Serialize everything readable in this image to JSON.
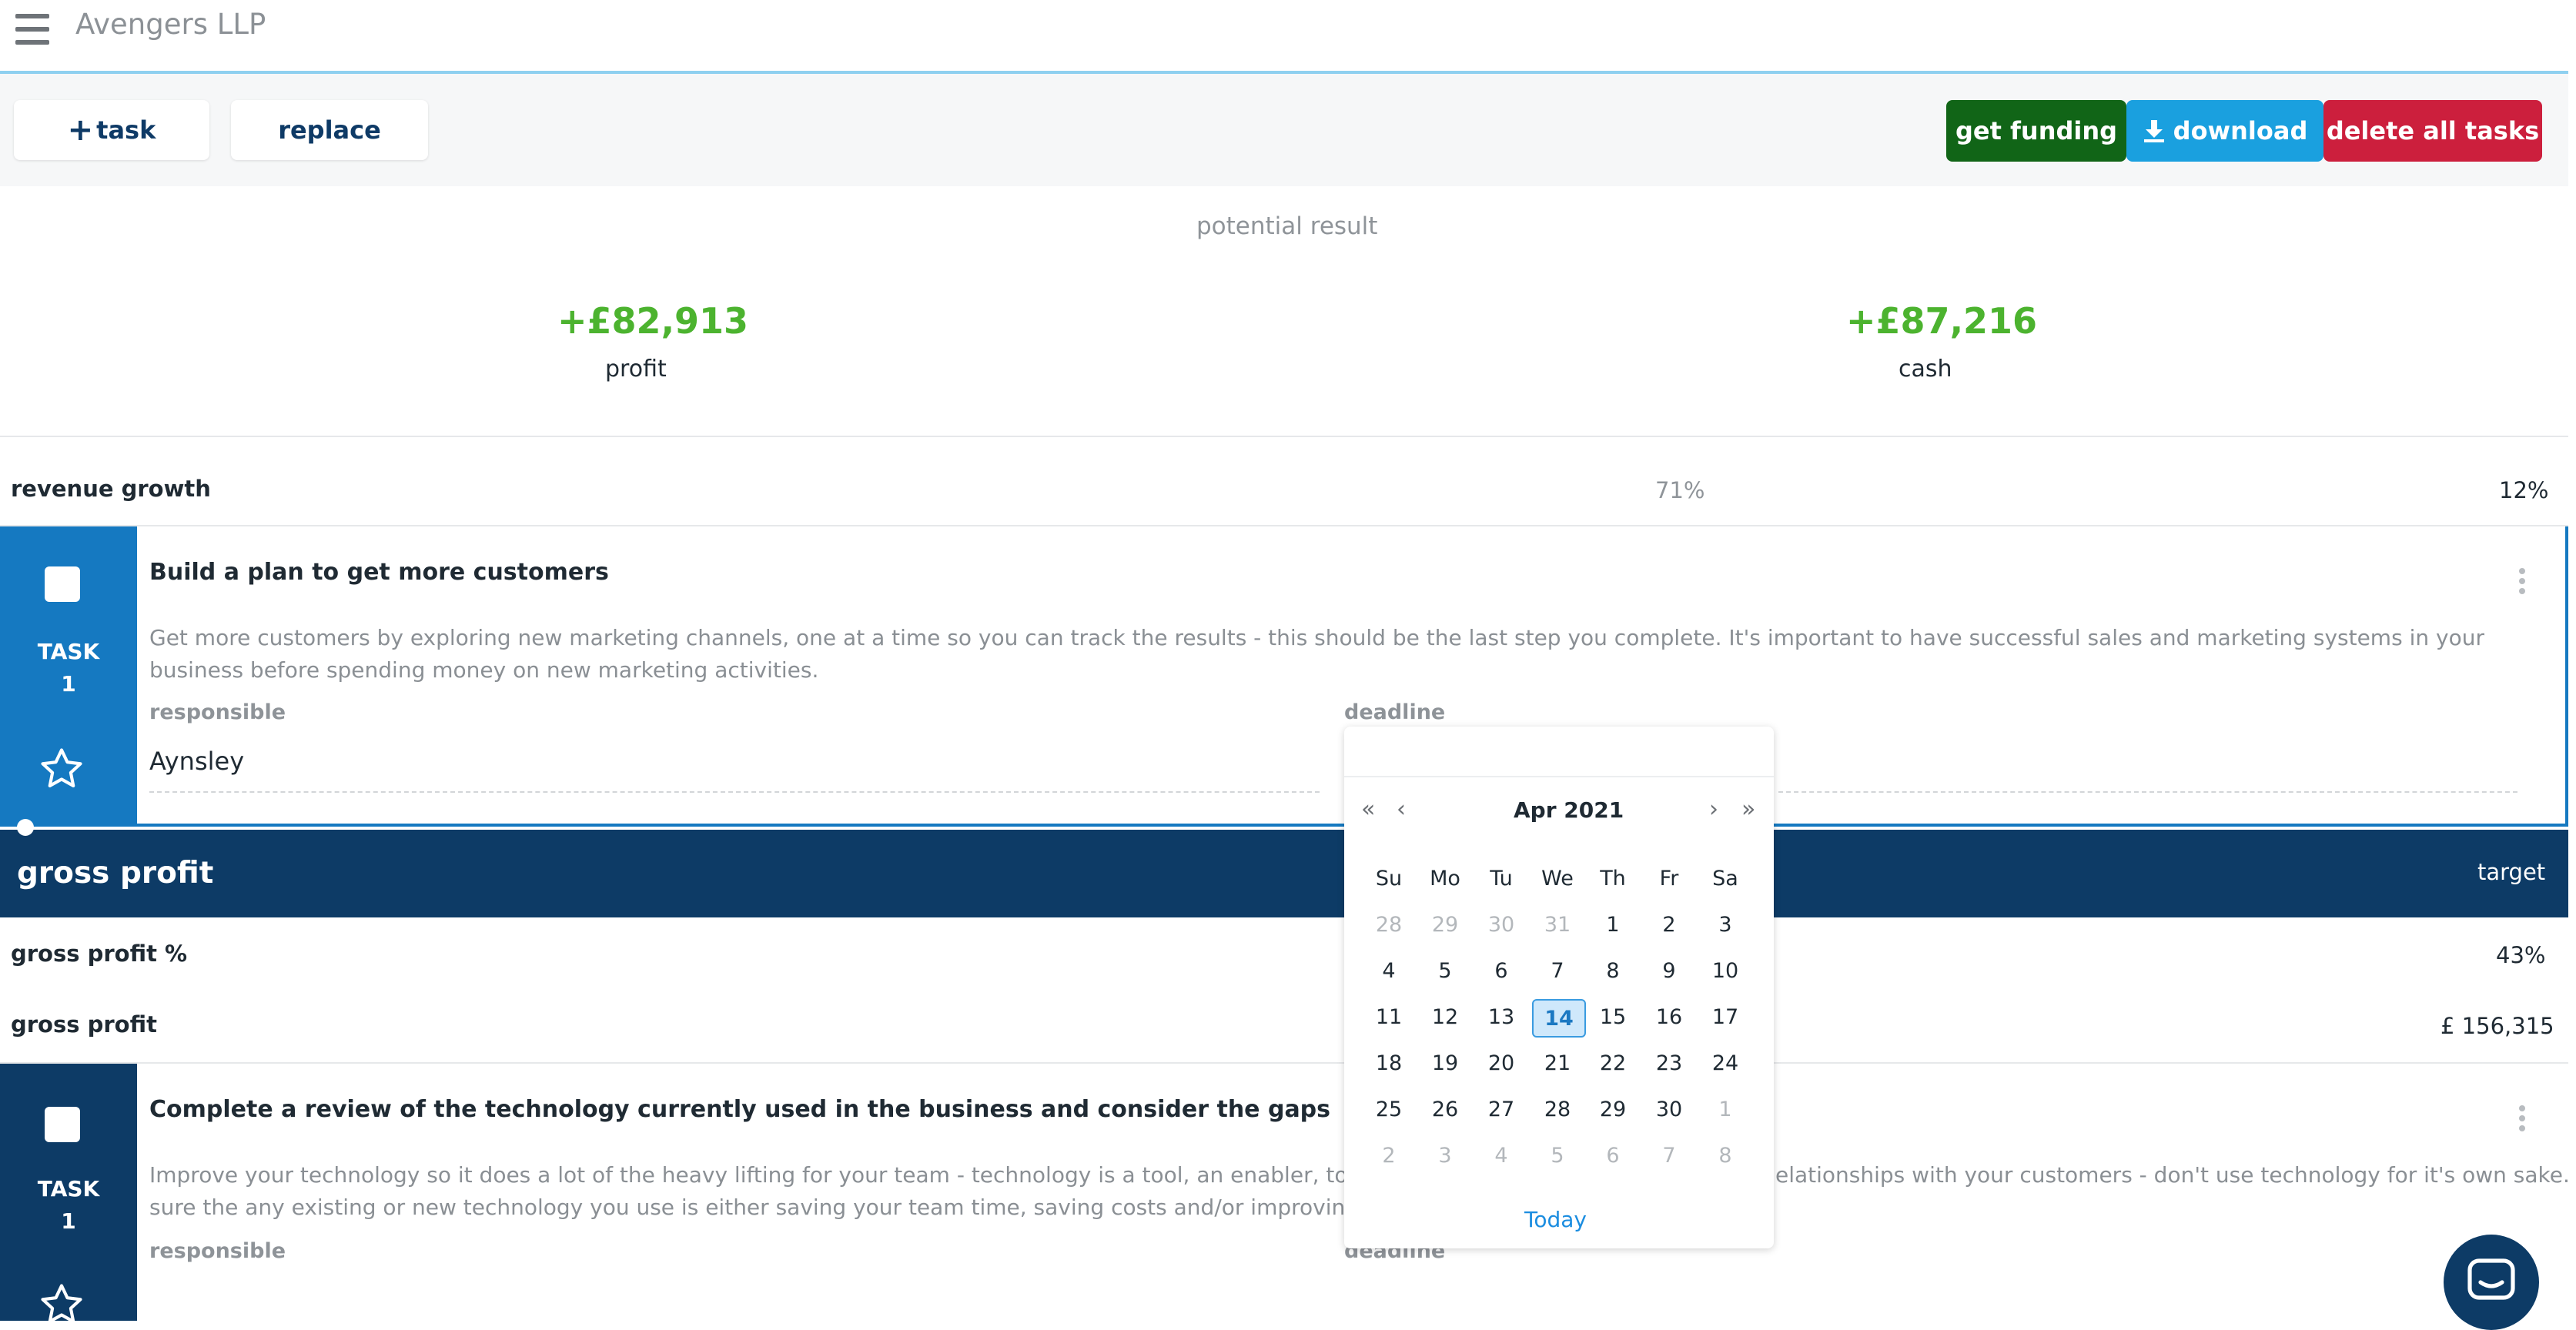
{
  "header": {
    "company": "Avengers LLP"
  },
  "toolbar": {
    "add_task_label": "task",
    "replace_label": "replace",
    "get_funding_label": "get funding",
    "download_label": "download",
    "delete_all_label": "delete all tasks",
    "colors": {
      "funding": "#116517",
      "download": "#1aa0df",
      "delete": "#cc1f3d"
    }
  },
  "potential": {
    "title": "potential result",
    "profit_value": "+£82,913",
    "profit_label": "profit",
    "cash_value": "+£87,216",
    "cash_label": "cash"
  },
  "revenue_row": {
    "label": "revenue growth",
    "current": "71%",
    "target": "12%"
  },
  "task1": {
    "task_word": "TASK",
    "number": "1",
    "title": "Build a plan to get more customers",
    "description": "Get more customers by exploring new marketing channels, one at a time so you can track the results - this should be the last step you complete. It's important to have successful sales and marketing systems in your business before spending money on new marketing activities.",
    "responsible_label": "responsible",
    "responsible_value": "Aynsley",
    "deadline_label": "deadline"
  },
  "gross_section": {
    "title": "gross profit",
    "target_label": "target",
    "rows": [
      {
        "label": "gross profit %",
        "value": "43%"
      },
      {
        "label": "gross profit",
        "value": "£ 156,315"
      }
    ]
  },
  "task2": {
    "task_word": "TASK",
    "number": "1",
    "title": "Complete a review of the technology currently used in the business and consider the gaps",
    "description_left_1": "Improve your technology so it does a lot of the heavy lifting for your team - technology is a tool, an enabler, to help reduce the",
    "description_right_1": "elationships with your customers - don't use technology for it's own sake. Make",
    "description_left_2": "sure the any existing or new technology you use is either saving your team time, saving costs and/or improving your customers'",
    "responsible_label": "responsible",
    "deadline_label": "deadline"
  },
  "datepicker": {
    "nav_prev_year": "«",
    "nav_prev_month": "‹",
    "month_label": "Apr 2021",
    "nav_next_month": "›",
    "nav_next_year": "»",
    "weekdays": [
      "Su",
      "Mo",
      "Tu",
      "We",
      "Th",
      "Fr",
      "Sa"
    ],
    "weeks": [
      [
        "28",
        "29",
        "30",
        "31",
        "1",
        "2",
        "3"
      ],
      [
        "4",
        "5",
        "6",
        "7",
        "8",
        "9",
        "10"
      ],
      [
        "11",
        "12",
        "13",
        "14",
        "15",
        "16",
        "17"
      ],
      [
        "18",
        "19",
        "20",
        "21",
        "22",
        "23",
        "24"
      ],
      [
        "25",
        "26",
        "27",
        "28",
        "29",
        "30",
        "1"
      ],
      [
        "2",
        "3",
        "4",
        "5",
        "6",
        "7",
        "8"
      ]
    ],
    "selected": "14",
    "today_label": "Today"
  }
}
